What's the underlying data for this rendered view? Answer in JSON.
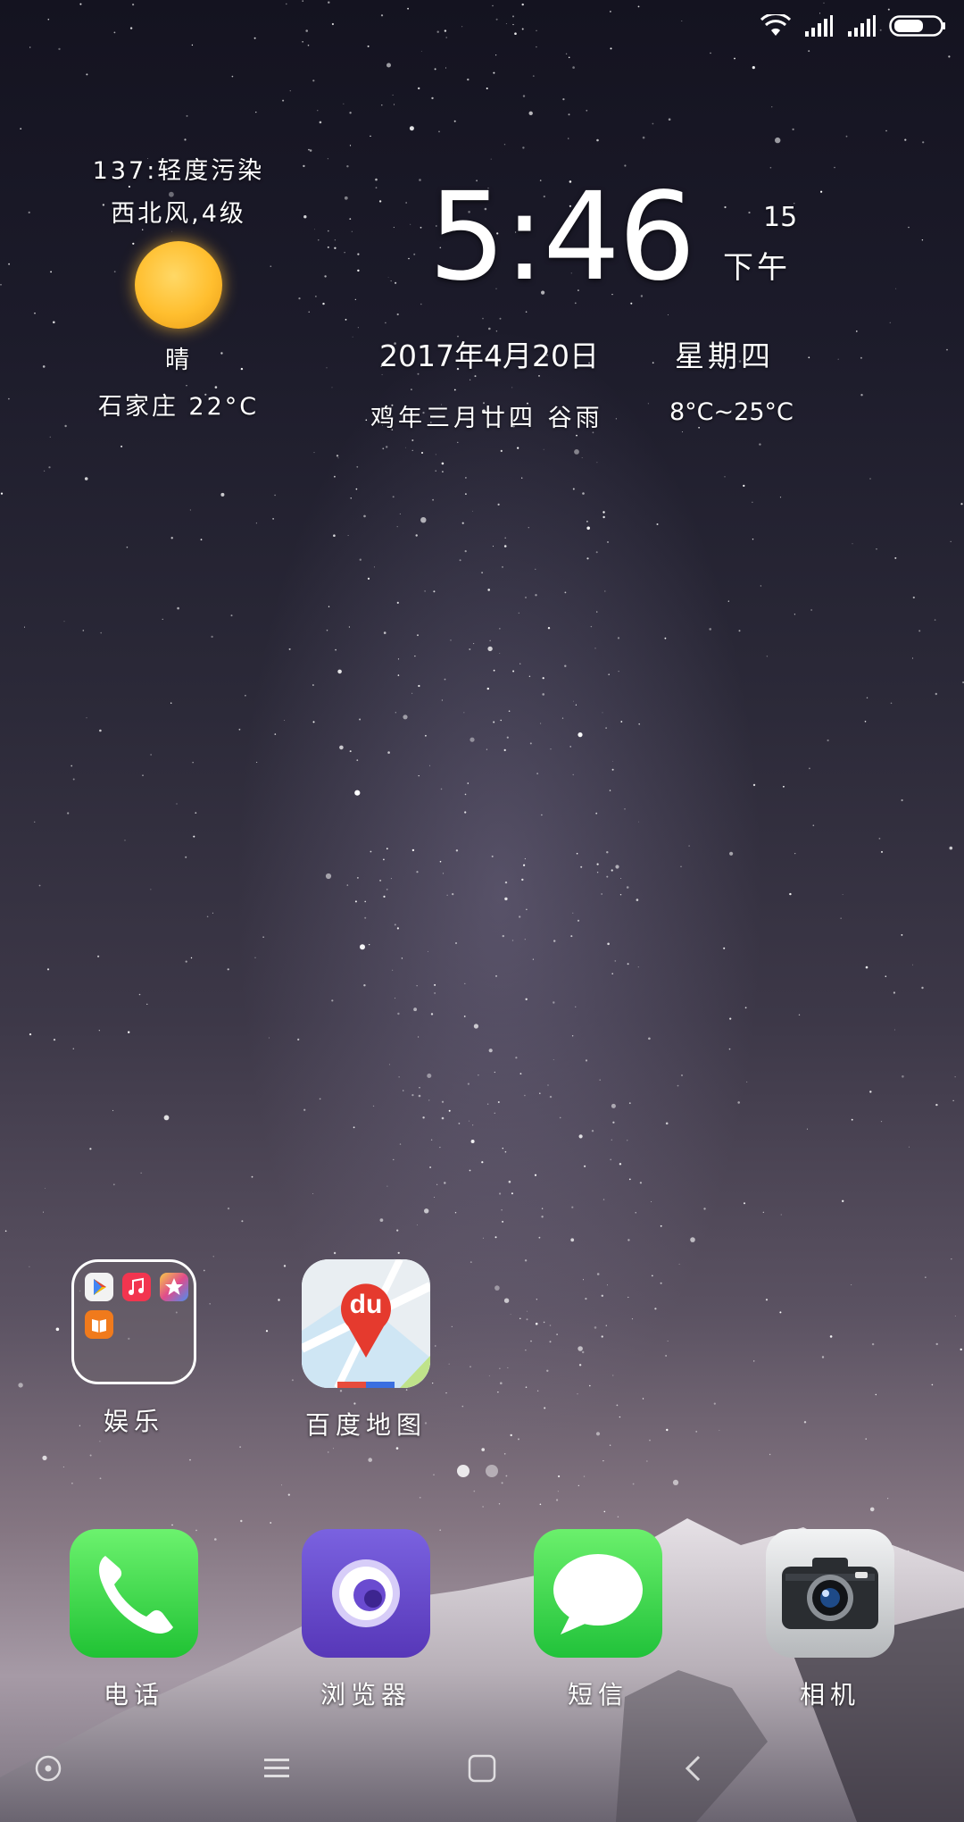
{
  "status_bar": {
    "icons": [
      "wifi-icon",
      "signal-icon",
      "signal-icon",
      "battery-icon"
    ]
  },
  "weather": {
    "aqi": "137:轻度污染",
    "wind": "西北风,4级",
    "condition_icon": "sun-icon",
    "condition": "晴",
    "city_temp": "石家庄 22°C"
  },
  "clock": {
    "time": "5:46",
    "seconds": "15",
    "ampm": "下午",
    "date": "2017年4月20日",
    "weekday": "星期四",
    "lunar": "鸡年三月廿四 谷雨",
    "temp_range": "8°C~25°C"
  },
  "apps": {
    "folder": {
      "label": "娱乐",
      "mini_icons": [
        "play-store-icon",
        "music-icon",
        "star-icon",
        "book-icon"
      ]
    },
    "baidu_map": {
      "label": "百度地图",
      "icon": "baidu-map-icon",
      "icon_text": "du"
    }
  },
  "page_indicator": {
    "count": 2,
    "active": 1
  },
  "dock": [
    {
      "label": "电话",
      "icon": "phone-icon"
    },
    {
      "label": "浏览器",
      "icon": "browser-icon"
    },
    {
      "label": "短信",
      "icon": "messages-icon"
    },
    {
      "label": "相机",
      "icon": "camera-icon"
    }
  ],
  "nav_bar": {
    "icons": [
      "assistant-icon",
      "menu-icon",
      "home-icon",
      "back-icon"
    ]
  },
  "colors": {
    "phone_green": "#35d44a",
    "browser_purple": "#6c4fd1",
    "messages_green": "#3fd64d",
    "map_red": "#e53a2e"
  }
}
